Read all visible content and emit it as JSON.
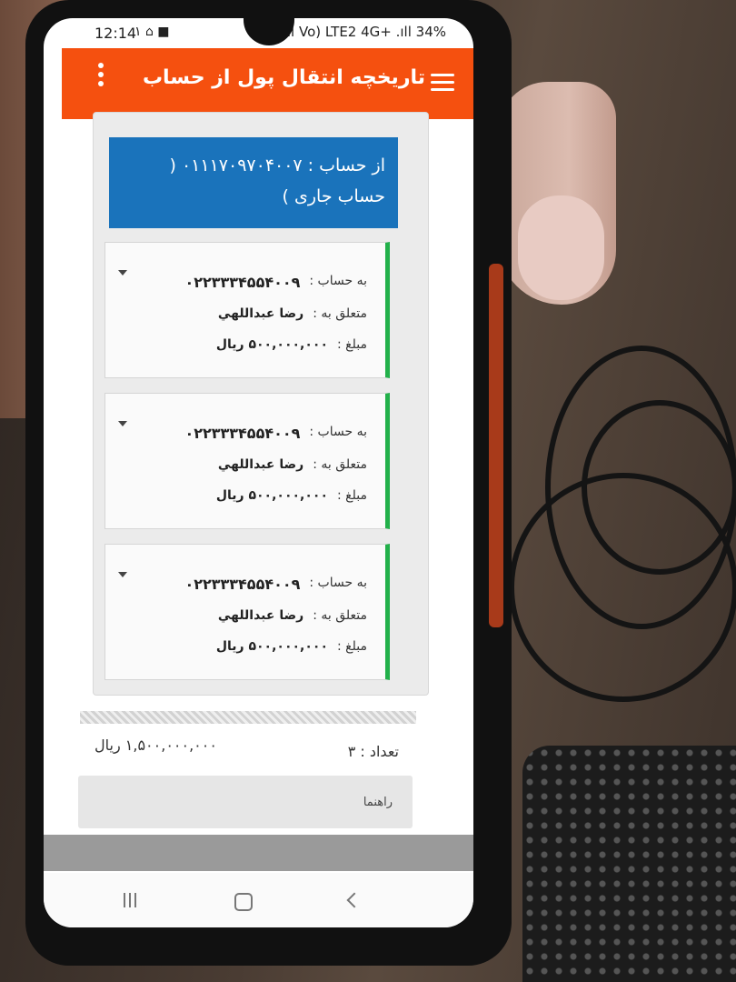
{
  "status_bar": {
    "time": "12:14",
    "notif": "۱ ⌂ ■",
    "right": "⏰ .ıll Vo) LTE2 4G+ .ıll 34%"
  },
  "app_bar": {
    "title": "تاریخچه انتقال پول از حساب"
  },
  "from_account": {
    "text": "از حساب : ۰۱۱۱۷۰۹۷۰۴۰۰۷ ( حساب جاری )"
  },
  "transfers": [
    {
      "to_label": "به حساب :",
      "to_account": "۰۲۲۳۳۳۴۵۵۴۰۰۹",
      "owner_label": "متعلق به :",
      "owner": "رضا عبداللهي",
      "amount_label": "مبلغ :",
      "amount": "۵۰۰,۰۰۰,۰۰۰ ريال"
    },
    {
      "to_label": "به حساب :",
      "to_account": "۰۲۲۳۳۳۴۵۵۴۰۰۹",
      "owner_label": "متعلق به :",
      "owner": "رضا عبداللهي",
      "amount_label": "مبلغ :",
      "amount": "۵۰۰,۰۰۰,۰۰۰ ريال"
    },
    {
      "to_label": "به حساب :",
      "to_account": "۰۲۲۳۳۳۴۵۵۴۰۰۹",
      "owner_label": "متعلق به :",
      "owner": "رضا عبداللهي",
      "amount_label": "مبلغ :",
      "amount": "۵۰۰,۰۰۰,۰۰۰ ريال"
    }
  ],
  "summary": {
    "total": "۱,۵۰۰,۰۰۰,۰۰۰ ريال",
    "count": "تعداد : ۳"
  },
  "guide": {
    "label": "راهنما"
  },
  "colors": {
    "app_bar": "#f5500f",
    "from_box": "#1a73bb",
    "card_accent": "#22b04a"
  }
}
